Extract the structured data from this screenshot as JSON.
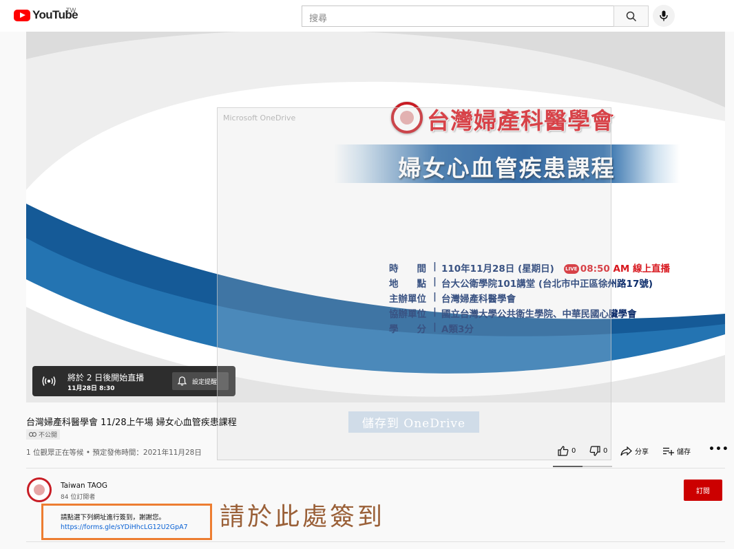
{
  "header": {
    "logo_text": "YouTube",
    "region": "TW",
    "search_placeholder": "搜尋"
  },
  "video": {
    "slide": {
      "org_name": "台灣婦產科醫學會",
      "course_title": "婦女心血管疾患課程",
      "info": [
        {
          "label": "時　　間",
          "value": "110年11月28日 (星期日)",
          "live_badge": "LIVE",
          "live_time": "08:50 AM 線上直播"
        },
        {
          "label": "地　　點",
          "value": "台大公衛學院101講堂 (台北市中正區徐州路17號)"
        },
        {
          "label": "主辦單位",
          "value": "台灣婦產科醫學會"
        },
        {
          "label": "協辦單位",
          "value": "國立台灣大學公共衛生學院、中華民國心臟學會"
        },
        {
          "label": "學　　分",
          "value": "A類3分"
        }
      ],
      "separator": "|"
    },
    "onedrive_title": "Microsoft OneDrive",
    "onedrive_save": "儲存到 OneDrive",
    "live_chip": {
      "line1": "將於 2 日後開始直播",
      "line2": "11月28日 8:30",
      "reminder_label": "設定提醒"
    }
  },
  "info": {
    "title": "台灣婦產科醫學會 11/28上午場 婦女心血管疾患課程",
    "privacy": "不公開",
    "meta": "1 位觀眾正在等候 • 預定發佈時間：2021年11月28日"
  },
  "actions": {
    "like_count": "0",
    "dislike_count": "0",
    "share_label": "分享",
    "save_label": "儲存",
    "more_label": "•••",
    "like_ratio": 0.5
  },
  "channel": {
    "name": "Taiwan TAOG",
    "subscribers": "84 位訂閱者",
    "subscribe_label": "訂閱"
  },
  "description": {
    "line1": "請點選下列網址進行簽到，謝謝您。",
    "link": "https://forms.gle/sYDiHhcLG12U2GpA7"
  },
  "annotation": {
    "note": "請於此處簽到",
    "box_color": "#ed7d31"
  }
}
